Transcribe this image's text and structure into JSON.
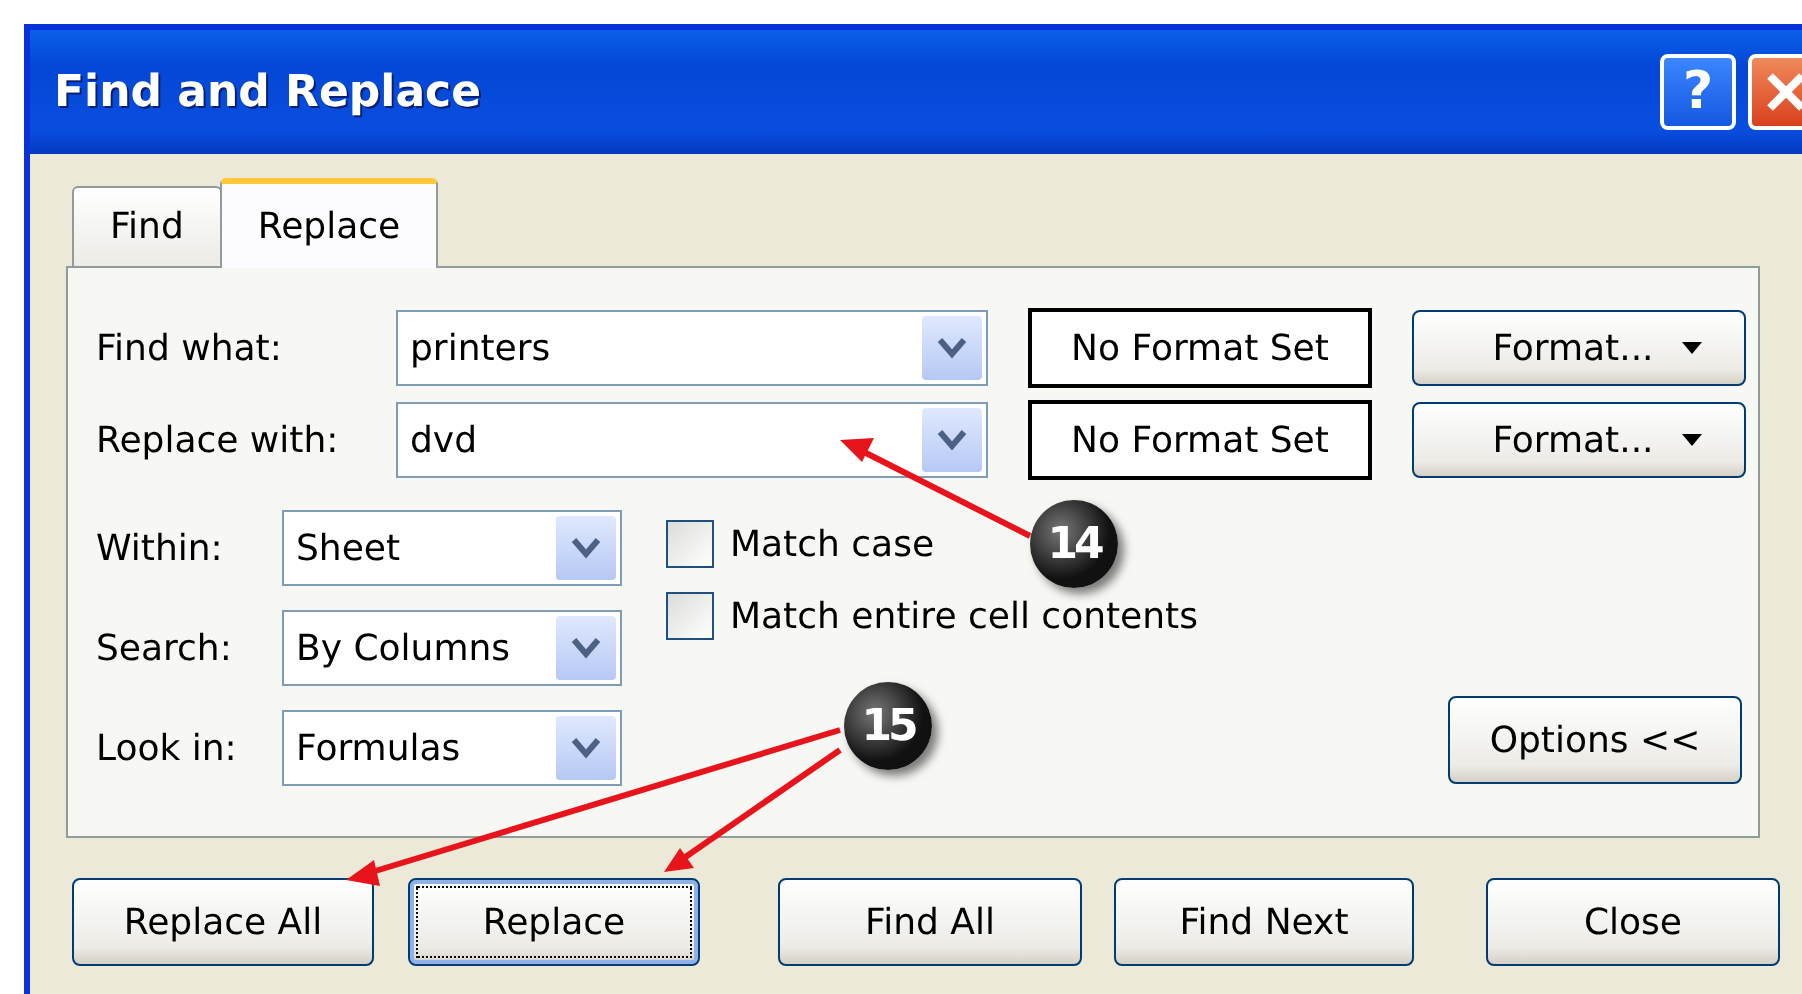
{
  "window": {
    "title": "Find and Replace",
    "title_buttons": [
      "?"
    ]
  },
  "tabs": [
    {
      "label": "Find",
      "selected": false
    },
    {
      "label": "Replace",
      "selected": true
    }
  ],
  "criteria": [
    {
      "label": "Find what:",
      "value": "printers",
      "format_status": "No Format Set",
      "format_button": "Format..."
    },
    {
      "label": "Replace with:",
      "value": "dvd",
      "format_status": "No Format Set",
      "format_button": "Format..."
    }
  ],
  "options": [
    {
      "label": "Within:",
      "value": "Sheet"
    },
    {
      "label": "Search:",
      "value": "By Columns"
    },
    {
      "label": "Look in:",
      "value": "Formulas"
    }
  ],
  "checkboxes": [
    {
      "label": "Match case",
      "checked": false
    },
    {
      "label": "Match entire cell contents",
      "checked": false
    }
  ],
  "options_button": "Options <<",
  "buttons": [
    {
      "label": "Replace All",
      "focused": false
    },
    {
      "label": "Replace",
      "focused": true
    },
    {
      "label": "Find All",
      "focused": false
    },
    {
      "label": "Find Next",
      "focused": false
    },
    {
      "label": "Close",
      "focused": false
    }
  ],
  "callouts": [
    {
      "label": "14"
    },
    {
      "label": "15"
    }
  ]
}
